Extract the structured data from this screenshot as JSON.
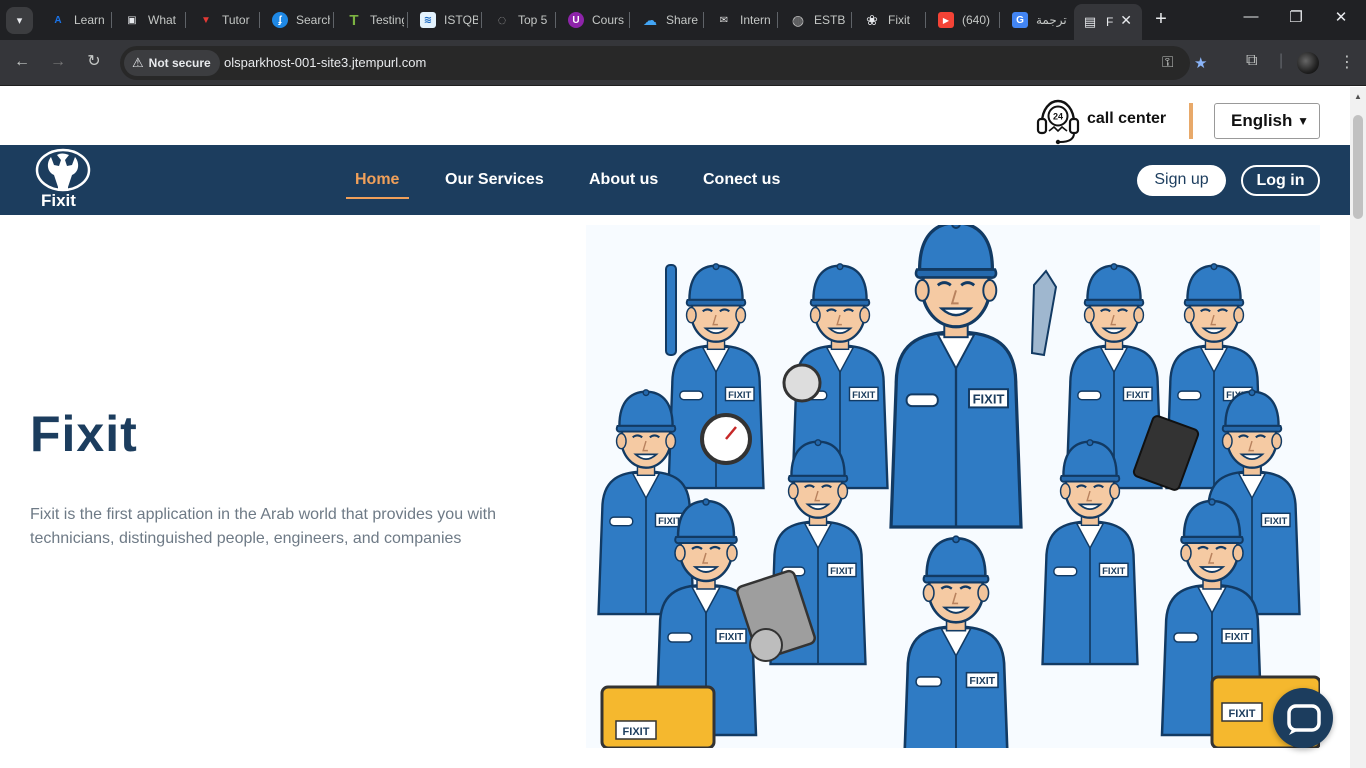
{
  "browser": {
    "tabs": [
      {
        "label": "Learn",
        "fav_color": "#1a73e8",
        "fav_glyph": "A"
      },
      {
        "label": "What",
        "fav_color": "#e8eaed",
        "fav_glyph": "▣"
      },
      {
        "label": "Tutor",
        "fav_color": "#e53935",
        "fav_glyph": "▼"
      },
      {
        "label": "Search",
        "fav_color": "#1e88e5",
        "fav_glyph": "ʄ"
      },
      {
        "label": "Testing",
        "fav_color": "#7cb342",
        "fav_glyph": "T"
      },
      {
        "label": "ISTQB",
        "fav_color": "#90caf9",
        "fav_glyph": "≋"
      },
      {
        "label": "Top 5",
        "fav_color": "#9e9e9e",
        "fav_glyph": "◌"
      },
      {
        "label": "Cours",
        "fav_color": "#8e24aa",
        "fav_glyph": "U"
      },
      {
        "label": "Share",
        "fav_color": "#42a5f5",
        "fav_glyph": "☁"
      },
      {
        "label": "Intern",
        "fav_color": "#e0e0e0",
        "fav_glyph": "✉"
      },
      {
        "label": "ESTB",
        "fav_color": "#bdbdbd",
        "fav_glyph": "◍"
      },
      {
        "label": "Fixit",
        "fav_color": "#e8eaed",
        "fav_glyph": "❀"
      },
      {
        "label": "(640)",
        "fav_color": "#f44336",
        "fav_glyph": "▶"
      },
      {
        "label": "ترجمة",
        "fav_color": "#4285f4",
        "fav_glyph": "G"
      }
    ],
    "active_tab": {
      "label": "F",
      "fav_glyph": "▤"
    },
    "security_label": "Not secure",
    "url": "olsparkhost-001-site3.jtempurl.com"
  },
  "topbar": {
    "call_center_label": "call center",
    "call_center_badge": "24",
    "language": {
      "selected": "English"
    }
  },
  "navbar": {
    "brand": "Fixit",
    "links": [
      {
        "label": "Home",
        "active": true
      },
      {
        "label": "Our Services",
        "active": false
      },
      {
        "label": "About us",
        "active": false
      },
      {
        "label": "Conect us",
        "active": false
      }
    ],
    "signup_label": "Sign up",
    "login_label": "Log in"
  },
  "hero": {
    "title": "Fixit",
    "description": "Fixit is the first application in the Arab world that provides you with technicians, distinguished people, engineers, and companies",
    "uniform_badge": "FIXIT"
  },
  "colors": {
    "navy": "#1c3d5e",
    "accent": "#f0a05a",
    "uniform": "#2f7bc4",
    "toolbox": "#f5b82e"
  }
}
